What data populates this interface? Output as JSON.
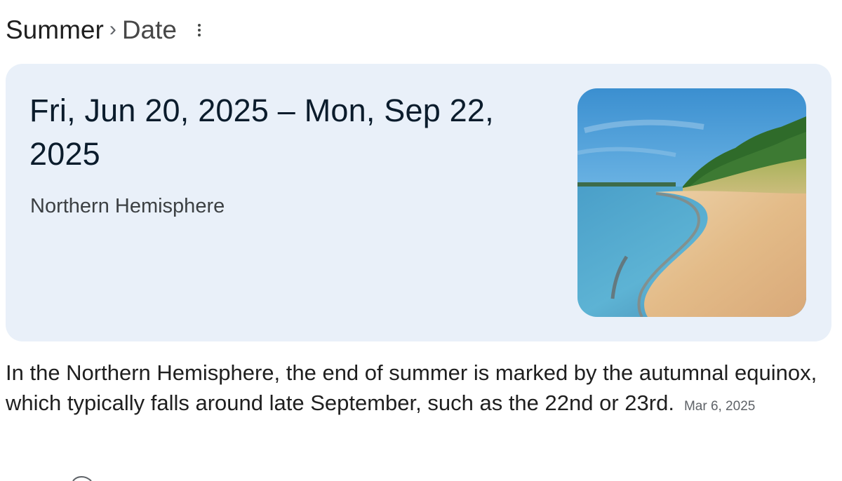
{
  "breadcrumb": {
    "root": "Summer",
    "separator": "›",
    "current": "Date",
    "more_icon": "more-vert-icon"
  },
  "card": {
    "date_range": "Fri, Jun 20, 2025 – Mon, Sep 22, 2025",
    "subtitle": "Northern Hemisphere",
    "image_icon": "beach-photo",
    "background_color": "#e9f0f9"
  },
  "snippet": {
    "text": "In the Northern Hemisphere, the end of summer is marked by the autumnal equinox, which typically falls around late September, such as the 22nd or 23rd.",
    "date": "Mar 6, 2025"
  }
}
